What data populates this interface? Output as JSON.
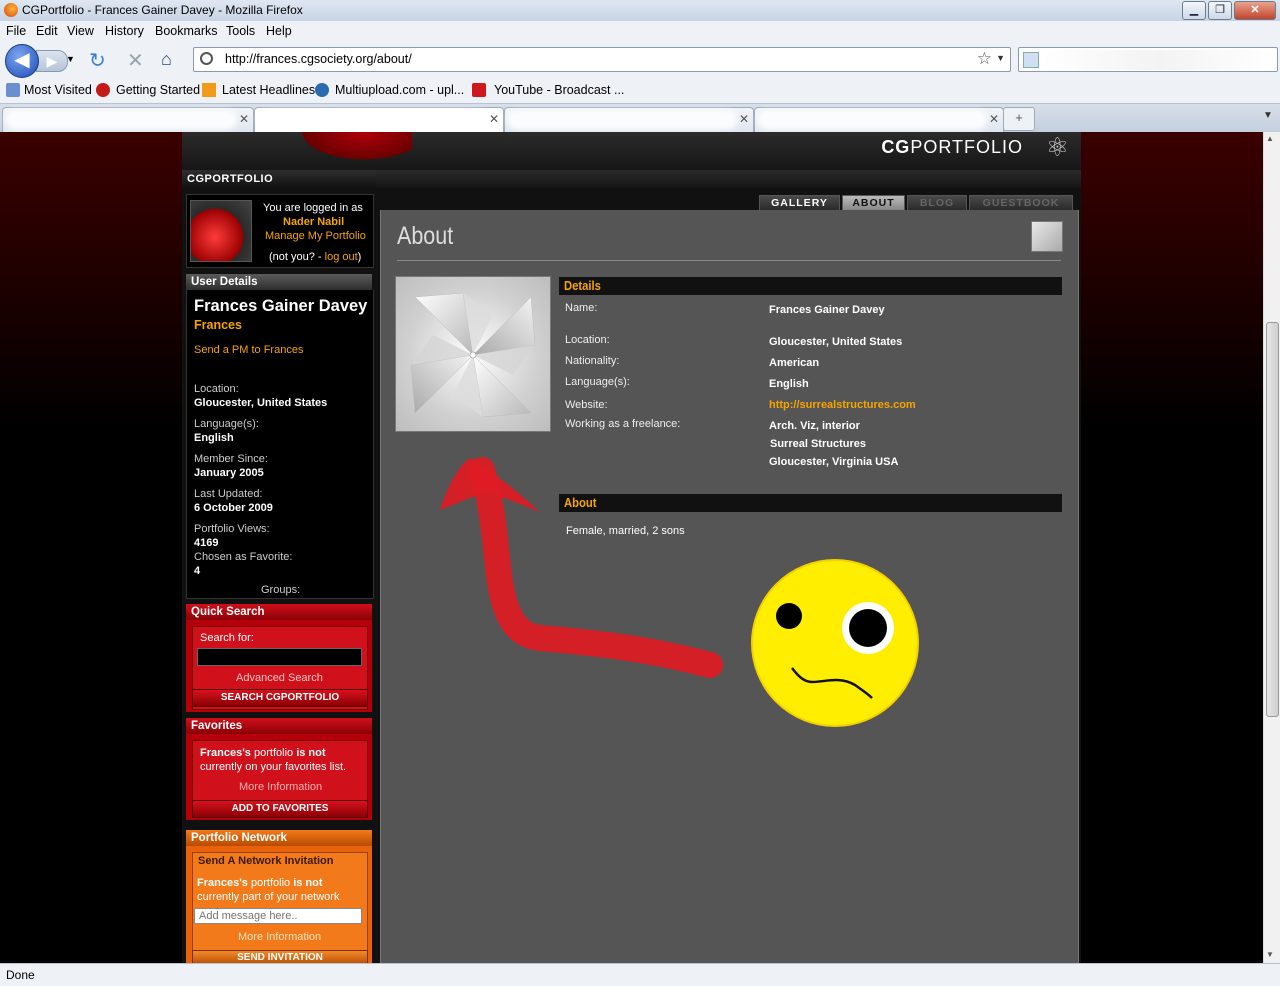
{
  "window": {
    "title": "CGPortfolio - Frances Gainer Davey - Mozilla Firefox"
  },
  "menu": [
    "File",
    "Edit",
    "View",
    "History",
    "Bookmarks",
    "Tools",
    "Help"
  ],
  "address": {
    "url": "http://frances.cgsociety.org/about/"
  },
  "bookmarks": [
    "Most Visited",
    "Getting Started",
    "Latest Headlines",
    "Multiupload.com - upl...",
    "YouTube - Broadcast ..."
  ],
  "site": {
    "logo_bold": "CG",
    "logo_rest": "PORTFOLIO",
    "section_label": "CGPORTFOLIO"
  },
  "login": {
    "line1": "You are logged in as",
    "user": "Nader Nabil",
    "manage": "Manage My Portfolio",
    "notyou": "(not you? - ",
    "logout": "log out",
    "close_paren": ")"
  },
  "user_details": {
    "header": "User Details",
    "name": "Frances Gainer Davey",
    "first_name": "Frances",
    "pm_link": "Send a PM to Frances",
    "location_label": "Location:",
    "location": "Gloucester, United States",
    "languages_label": "Language(s):",
    "languages": "English",
    "member_since_label": "Member Since:",
    "member_since": "January 2005",
    "last_updated_label": "Last Updated:",
    "last_updated": "6 October 2009",
    "views_label": "Portfolio Views:",
    "views": "4169",
    "favorite_label": "Chosen as Favorite:",
    "favorite": "4",
    "groups_label": "Groups:"
  },
  "quick_search": {
    "header": "Quick Search",
    "label": "Search for:",
    "advanced": "Advanced Search",
    "button": "SEARCH CGPORTFOLIO"
  },
  "favorites": {
    "header": "Favorites",
    "name": "Frances's",
    "t1": " portfolio ",
    "t2": "is not",
    "t3": " currently on your favorites list.",
    "more": "More Information",
    "button": "ADD TO FAVORITES"
  },
  "network": {
    "header": "Portfolio Network",
    "title": "Send A Network Invitation",
    "name": "Frances's",
    "t1": " portfolio ",
    "t2": "is not",
    "t3": " currently part of your network",
    "placeholder": "Add message here..",
    "more": "More Information",
    "button": "SEND INVITATION"
  },
  "tabs": {
    "gallery": "GALLERY",
    "about": "ABOUT",
    "blog": "BLOG",
    "guestbook": "GUESTBOOK"
  },
  "about_page": {
    "title": "About",
    "details_header": "Details",
    "details": {
      "name_label": "Name:",
      "name": "Frances Gainer Davey",
      "location_label": "Location:",
      "location": "Gloucester, United States",
      "nationality_label": "Nationality:",
      "nationality": "American",
      "languages_label": "Language(s):",
      "languages": "English",
      "website_label": "Website:",
      "website": "http://surrealstructures.com",
      "freelance_label": "Working as a freelance:",
      "freelance_1": "Arch. Viz, interior",
      "freelance_2": "Surreal Structures",
      "freelance_3": "Gloucester, Virginia USA"
    },
    "about_header": "About",
    "about_text": "Female, married, 2 sons"
  },
  "status": {
    "text": "Done"
  },
  "colors": {
    "accent_orange": "#f6a400",
    "panel_gray": "#555555",
    "red": "#d0101a",
    "smiley_yellow": "#ffee00",
    "arrow_red": "#e01b24"
  }
}
